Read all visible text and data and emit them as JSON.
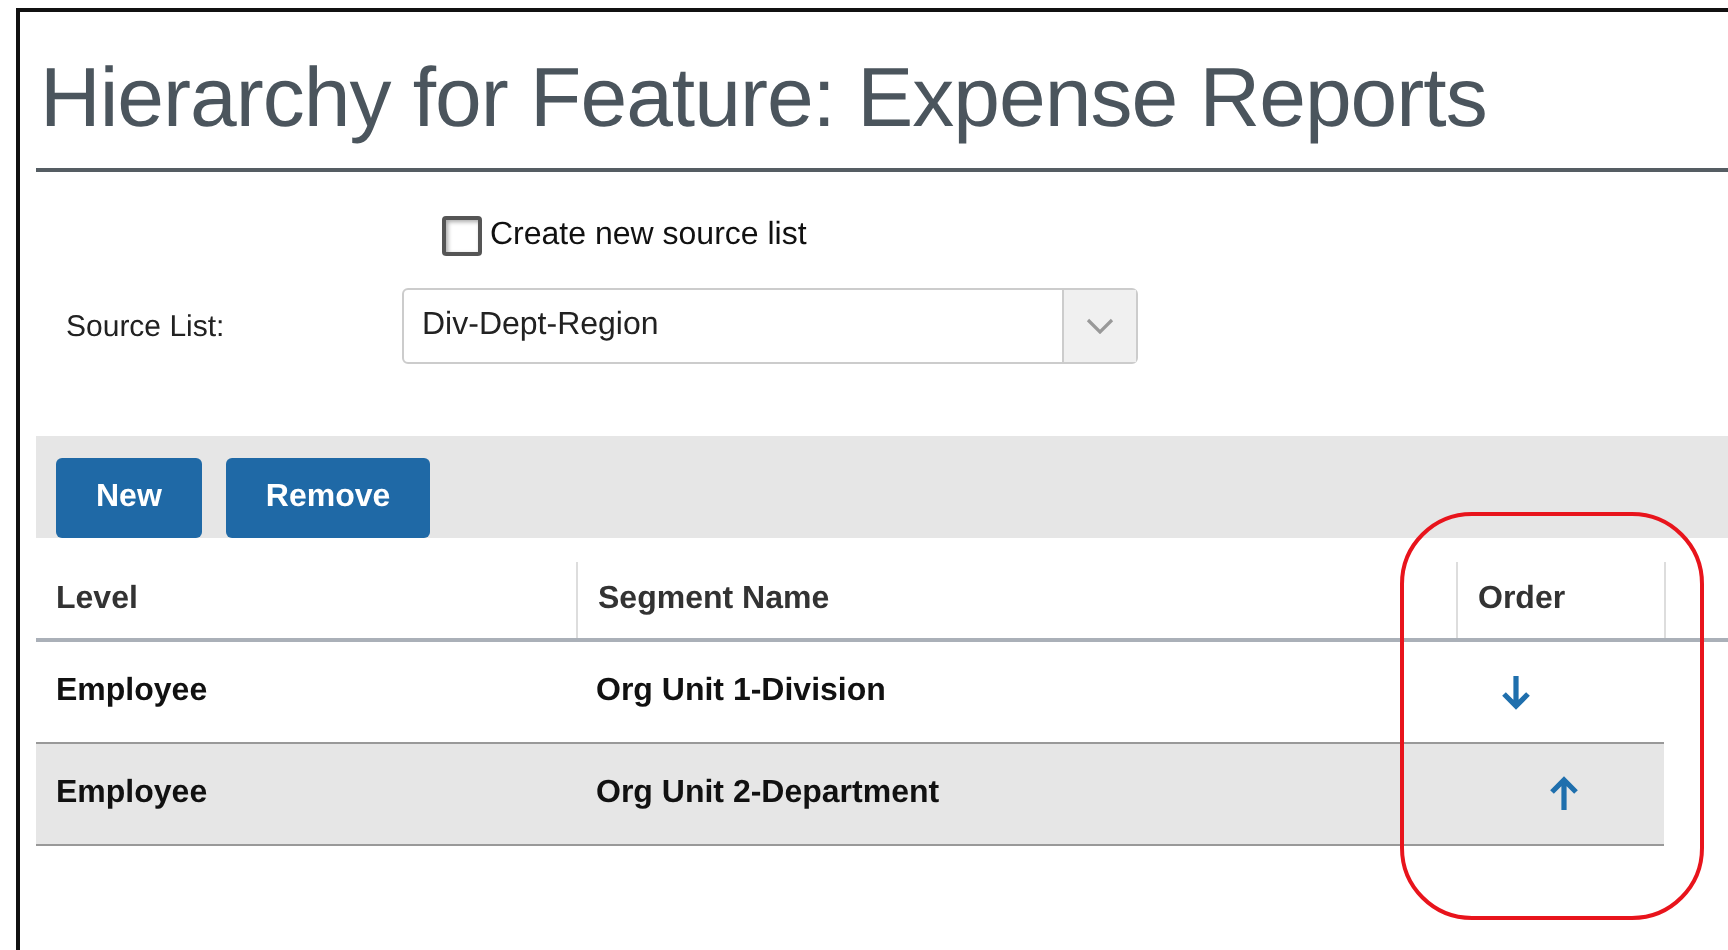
{
  "title": "Hierarchy for Feature: Expense Reports",
  "create_new_source_list": {
    "label": "Create new source list",
    "checked": false
  },
  "source_list": {
    "label": "Source List:",
    "value": "Div-Dept-Region"
  },
  "toolbar": {
    "buttons": [
      "New",
      "Remove"
    ]
  },
  "table": {
    "columns": [
      "Level",
      "Segment Name",
      "Order"
    ],
    "rows": [
      {
        "level": "Employee",
        "segment_name": "Org Unit 1-Division",
        "order_arrow": {
          "kind": "down"
        },
        "selected": false
      },
      {
        "level": "Employee",
        "segment_name": "Org Unit 2-Department",
        "order_arrow": {
          "kind": "up"
        },
        "selected": true
      }
    ]
  },
  "annotation": {
    "kind": "highlight-circle",
    "color": "#e8141c"
  }
}
